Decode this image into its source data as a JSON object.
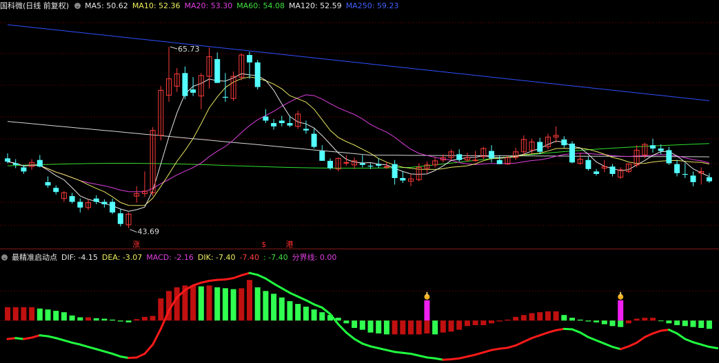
{
  "header": {
    "title": "国科微(日线 前复权)",
    "ma": [
      {
        "label": "MA5: 50.62",
        "color": "#e8e8e8"
      },
      {
        "label": "MA10: 52.36",
        "color": "#f0f060"
      },
      {
        "label": "MA20: 53.30",
        "color": "#e040e0"
      },
      {
        "label": "MA60: 54.08",
        "color": "#40e040"
      },
      {
        "label": "MA120: 52.59",
        "color": "#e8e8e8"
      },
      {
        "label": "MA250: 59.23",
        "color": "#4060ff"
      }
    ]
  },
  "indicator": {
    "title": "最精准启动点",
    "items": [
      {
        "label": "DIF: -4.15",
        "color": "#e8e8e8"
      },
      {
        "label": "DEA: -3.07",
        "color": "#f0f060"
      },
      {
        "label": "MACD: -2.16",
        "color": "#e040e0"
      },
      {
        "label": "DIK: -7.40",
        "color": "#f0f060"
      },
      {
        "label": "-7.40",
        "color": "#ff4040"
      },
      {
        "label": ": -7.40",
        "color": "#40e040"
      },
      {
        "label": "分界线: 0.00",
        "color": "#e040e0"
      }
    ]
  },
  "annotations": {
    "high": "65.73",
    "low": "43.69",
    "markers": [
      "涨",
      "$",
      "港"
    ]
  },
  "colors": {
    "up": "#ff3b3b",
    "down": "#54ffff",
    "grid": "#8b0000",
    "sep": "#8b1a1a"
  },
  "chart_data": [
    {
      "type": "candlestick",
      "title": "国科微(日线 前复权)",
      "ylim": [
        42,
        70
      ],
      "series": [
        {
          "name": "K",
          "ohlc": [
            [
              52.2,
              52.8,
              51.6,
              51.8
            ],
            [
              51.6,
              52.1,
              51.0,
              51.4
            ],
            [
              51.1,
              51.4,
              50.3,
              50.6
            ],
            [
              51.2,
              52.1,
              50.8,
              51.7
            ],
            [
              52.0,
              52.6,
              51.1,
              51.2
            ],
            [
              49.3,
              50.0,
              48.6,
              48.9
            ],
            [
              48.6,
              48.9,
              47.8,
              48.1
            ],
            [
              47.3,
              48.2,
              46.9,
              48.0
            ],
            [
              47.6,
              48.0,
              46.7,
              46.9
            ],
            [
              46.9,
              47.3,
              45.6,
              46.2
            ],
            [
              46.2,
              47.2,
              45.9,
              46.8
            ],
            [
              47.3,
              47.7,
              46.6,
              46.9
            ],
            [
              46.9,
              47.2,
              46.2,
              46.6
            ],
            [
              46.9,
              47.3,
              45.4,
              45.6
            ],
            [
              45.5,
              46.0,
              43.9,
              44.2
            ],
            [
              44.1,
              45.6,
              43.7,
              45.4
            ],
            [
              47.6,
              48.8,
              46.8,
              47.9
            ],
            [
              47.9,
              50.6,
              47.5,
              48.2
            ],
            [
              48.0,
              56.0,
              47.6,
              55.6
            ],
            [
              55.0,
              61.0,
              54.4,
              60.5
            ],
            [
              59.9,
              65.8,
              59.1,
              61.9
            ],
            [
              61.0,
              63.2,
              60.3,
              62.5
            ],
            [
              62.6,
              63.4,
              59.4,
              59.8
            ],
            [
              60.6,
              62.1,
              59.8,
              60.2
            ],
            [
              59.8,
              62.6,
              58.2,
              62.3
            ],
            [
              62.2,
              65.7,
              60.7,
              64.6
            ],
            [
              64.3,
              65.1,
              61.4,
              61.4
            ],
            [
              59.7,
              62.6,
              59.1,
              59.6
            ],
            [
              59.5,
              62.8,
              59.2,
              62.2
            ],
            [
              62.1,
              65.0,
              61.7,
              64.8
            ],
            [
              64.8,
              65.2,
              61.9,
              63.9
            ],
            [
              63.9,
              64.2,
              60.6,
              60.9
            ],
            [
              57.3,
              58.2,
              56.5,
              56.8
            ],
            [
              56.5,
              57.0,
              55.7,
              56.1
            ],
            [
              56.8,
              57.4,
              56.1,
              56.5
            ],
            [
              56.5,
              57.4,
              56.0,
              56.2
            ],
            [
              56.1,
              58.0,
              55.8,
              57.6
            ],
            [
              55.8,
              56.8,
              55.2,
              55.6
            ],
            [
              55.2,
              55.8,
              53.4,
              53.6
            ],
            [
              53.1,
              53.8,
              51.9,
              51.9
            ],
            [
              51.9,
              52.2,
              50.8,
              51.0
            ],
            [
              50.9,
              52.3,
              50.6,
              52.2
            ],
            [
              51.7,
              52.6,
              51.3,
              51.7
            ],
            [
              51.4,
              52.3,
              50.9,
              51.9
            ],
            [
              51.6,
              52.6,
              51.1,
              51.4
            ],
            [
              51.3,
              51.6,
              50.9,
              51.2
            ],
            [
              51.5,
              52.2,
              51.0,
              51.3
            ],
            [
              51.2,
              51.8,
              50.9,
              51.2
            ],
            [
              51.5,
              52.0,
              49.0,
              49.8
            ],
            [
              49.8,
              50.6,
              49.2,
              49.5
            ],
            [
              49.4,
              50.3,
              48.8,
              49.7
            ],
            [
              49.6,
              51.6,
              49.4,
              51.1
            ],
            [
              51.0,
              51.8,
              50.4,
              51.4
            ],
            [
              51.4,
              52.3,
              51.1,
              51.9
            ],
            [
              52.0,
              52.7,
              51.7,
              52.3
            ],
            [
              52.3,
              53.3,
              52.0,
              53.0
            ],
            [
              52.7,
              53.3,
              51.8,
              52.0
            ],
            [
              52.0,
              52.9,
              51.8,
              52.3
            ],
            [
              52.0,
              53.1,
              51.8,
              52.0
            ],
            [
              52.4,
              53.6,
              52.0,
              53.4
            ],
            [
              53.1,
              53.8,
              51.7,
              52.2
            ],
            [
              52.0,
              52.6,
              51.6,
              51.5
            ],
            [
              51.5,
              52.5,
              51.4,
              52.3
            ],
            [
              52.3,
              53.5,
              52.0,
              53.0
            ],
            [
              53.0,
              55.0,
              52.6,
              54.5
            ],
            [
              53.2,
              54.6,
              52.8,
              54.2
            ],
            [
              54.2,
              54.7,
              52.7,
              53.0
            ],
            [
              53.6,
              55.2,
              53.3,
              54.8
            ],
            [
              54.8,
              56.1,
              54.1,
              55.0
            ],
            [
              54.5,
              54.9,
              53.5,
              53.8
            ],
            [
              54.0,
              54.3,
              51.6,
              51.7
            ],
            [
              51.6,
              52.8,
              51.4,
              52.1
            ],
            [
              52.0,
              52.4,
              50.7,
              50.9
            ],
            [
              50.6,
              50.9,
              50.1,
              50.3
            ],
            [
              51.0,
              52.0,
              50.5,
              51.2
            ],
            [
              51.2,
              51.5,
              50.0,
              50.3
            ],
            [
              49.9,
              51.1,
              49.7,
              50.8
            ],
            [
              50.6,
              51.6,
              50.4,
              51.5
            ],
            [
              51.4,
              53.8,
              51.1,
              53.2
            ],
            [
              52.6,
              54.1,
              52.2,
              53.9
            ],
            [
              53.8,
              54.6,
              52.9,
              53.4
            ],
            [
              53.4,
              53.9,
              52.7,
              53.1
            ],
            [
              53.2,
              53.6,
              51.4,
              51.6
            ],
            [
              51.5,
              52.0,
              50.0,
              50.4
            ],
            [
              50.3,
              51.6,
              49.8,
              50.2
            ],
            [
              50.1,
              50.6,
              48.8,
              49.3
            ],
            [
              50.4,
              51.1,
              49.0,
              50.6
            ],
            [
              49.9,
              50.4,
              49.2,
              49.4
            ]
          ]
        },
        {
          "name": "MA5",
          "values": [
            50.62
          ]
        },
        {
          "name": "MA10",
          "values": [
            52.36
          ]
        },
        {
          "name": "MA20",
          "values": [
            53.3
          ]
        },
        {
          "name": "MA60",
          "values": [
            54.08
          ]
        },
        {
          "name": "MA120",
          "values": [
            52.59
          ]
        },
        {
          "name": "MA250",
          "values": [
            59.23
          ]
        }
      ]
    },
    {
      "type": "bar",
      "title": "最精准启动点",
      "ylim": [
        -4.6,
        6.2
      ],
      "series": [
        {
          "name": "MACD",
          "values": [
            1.45,
            1.45,
            1.45,
            1.45,
            1.3,
            1.2,
            1.05,
            0.9,
            0.55,
            0.35,
            0.35,
            0.25,
            0.2,
            0.1,
            -0.1,
            -0.2,
            0.15,
            0.4,
            0.5,
            2.4,
            3.2,
            3.6,
            3.8,
            3.8,
            3.7,
            3.8,
            3.6,
            3.5,
            3.4,
            3.5,
            4.4,
            3.6,
            3.2,
            2.9,
            2.5,
            2.1,
            1.8,
            1.5,
            1.2,
            0.9,
            0.6,
            0.3,
            -0.3,
            -0.8,
            -1.0,
            -1.3,
            -1.4,
            -1.5,
            -1.5,
            -1.5,
            -1.5,
            -1.5,
            -1.4,
            -1.5,
            -1.3,
            -1.2,
            -1.0,
            -0.6,
            -0.5,
            -0.5,
            -0.3,
            -0.1,
            0.1,
            0.4,
            0.6,
            0.8,
            0.9,
            1.0,
            1.0,
            0.6,
            0.3,
            0.1,
            -0.1,
            -0.2,
            -0.4,
            -0.6,
            -0.7,
            -0.3,
            0.2,
            0.3,
            0.3,
            0.0,
            -0.3,
            -0.5,
            -0.6,
            -0.7,
            -0.8,
            -0.9
          ]
        },
        {
          "name": "DIF",
          "values": [
            -2.0,
            -1.9,
            -2.0,
            -1.85,
            -1.6,
            -1.7,
            -1.9,
            -2.15,
            -2.4,
            -2.6,
            -2.85,
            -3.1,
            -3.35,
            -3.6,
            -3.9,
            -4.05,
            -4.0,
            -3.6,
            -2.6,
            -0.9,
            1.1,
            2.5,
            3.3,
            3.8,
            4.1,
            4.3,
            4.4,
            4.45,
            4.6,
            4.9,
            5.15,
            4.95,
            4.55,
            4.0,
            3.5,
            3.0,
            2.6,
            2.2,
            1.75,
            1.4,
            0.7,
            -0.4,
            -1.3,
            -2.0,
            -2.5,
            -2.8,
            -3.0,
            -3.2,
            -3.4,
            -3.5,
            -3.6,
            -3.8,
            -4.0,
            -4.1,
            -4.25,
            -4.2,
            -4.1,
            -3.9,
            -3.7,
            -3.45,
            -3.2,
            -3.05,
            -2.95,
            -2.7,
            -2.3,
            -1.9,
            -1.6,
            -1.3,
            -1.05,
            -0.9,
            -0.95,
            -1.3,
            -1.8,
            -2.15,
            -2.5,
            -2.85,
            -3.1,
            -2.8,
            -2.4,
            -1.8,
            -1.4,
            -1.1,
            -1.0,
            -1.4,
            -2.0,
            -2.35,
            -2.6,
            -2.85,
            -3.0
          ]
        }
      ]
    }
  ]
}
